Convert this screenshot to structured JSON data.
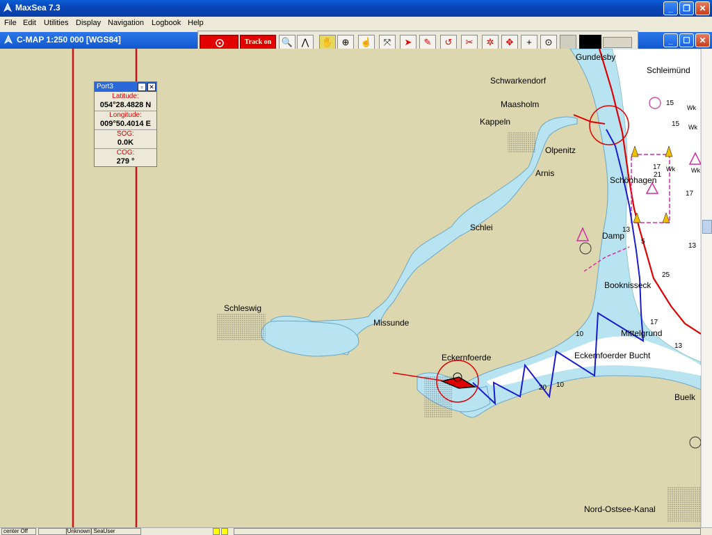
{
  "app": {
    "title": "MaxSea 7.3"
  },
  "menu": [
    "File",
    "Edit",
    "Utilities",
    "Display",
    "Navigation",
    "Logbook",
    "Help"
  ],
  "chart_window": {
    "title": "C-MAP  1:250 000 [WGS84]"
  },
  "toolbar": {
    "track_label": "Track on"
  },
  "instrument": {
    "title": "Port3",
    "latitude_label": "Latitude:",
    "latitude_value": "054°28.4828 N",
    "longitude_label": "Longitude:",
    "longitude_value": "009°50.4014 E",
    "sog_label": "SOG:",
    "sog_value": "0.0K",
    "cog_label": "COG:",
    "cog_value": "279 °"
  },
  "places": {
    "gundelsby": "Gundelsby",
    "schleimuende": "Schleimünd",
    "schwarkendorf": "Schwarkendorf",
    "maasholm": "Maasholm",
    "kappeln": "Kappeln",
    "olpenitz": "Olpenitz",
    "arnis": "Arnis",
    "schoenhagen": "Schönhagen",
    "schlei": "Schlei",
    "damp": "Damp",
    "booknisseck": "Booknisseck",
    "schleswig": "Schleswig",
    "missunde": "Missunde",
    "mittelgrund": "Mittelgrund",
    "eckernfoerde": "Eckernfoerde",
    "eckernfoerder_bucht": "Eckernfoerder Bucht",
    "buelk": "Buelk",
    "nord_ostsee_kanal": "Nord-Ostsee-Kanal"
  },
  "depths": [
    "15",
    "15",
    "17",
    "21",
    "17",
    "13",
    "13",
    "17",
    "13",
    "5",
    "10",
    "20",
    "10",
    "25"
  ],
  "depth_abbr": [
    "Wk",
    "Wk",
    "Wk",
    "Wk"
  ],
  "status": {
    "center": "center Off",
    "user": "[Unknown] SeaUser"
  },
  "colors": {
    "land": "#ddd7b0",
    "water": "#b8e4f2",
    "deep": "#ffffff",
    "track": "#1a1ad0",
    "heading": "#e00000"
  }
}
